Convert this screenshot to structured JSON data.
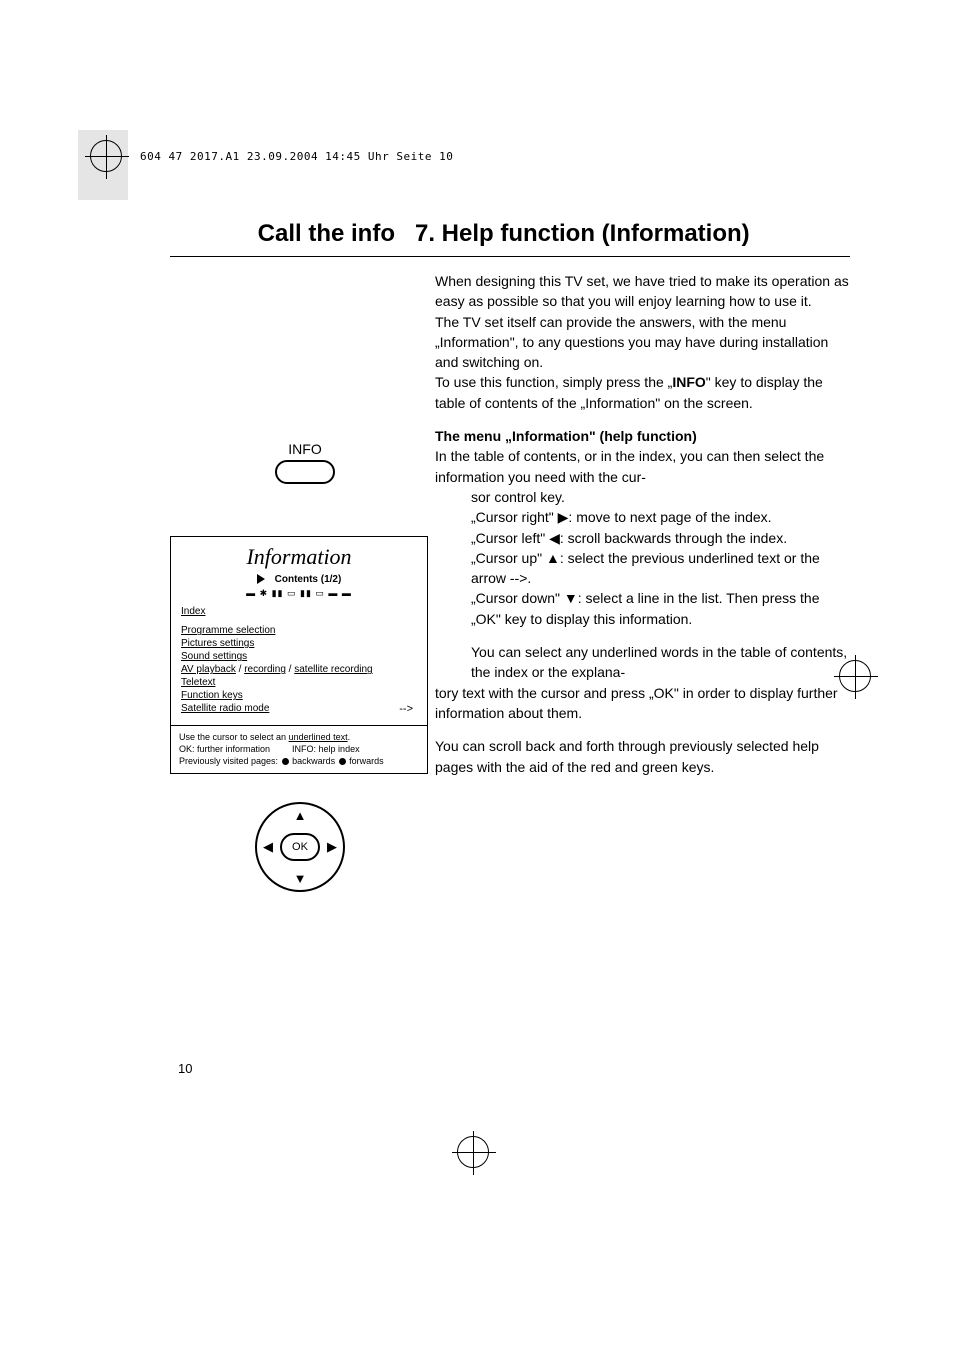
{
  "header_line": "604 47 2017.A1  23.09.2004  14:45 Uhr  Seite 10",
  "title_left": "Call the info",
  "title_right": "7. Help function (Information)",
  "info_label": "INFO",
  "para1": "When designing this TV set, we have tried to make its operation as easy as possible so that you will enjoy learning how to use it.",
  "para1b": "The TV set itself can provide the answers, with the menu „Information\", to any questions you may have during installation and switching on.",
  "para1c_a": "To use this function, simply press the „",
  "para1c_bold": "INFO",
  "para1c_b": "\" key to display the table of contents of the „Information\" on the screen.",
  "subhead": "The menu „Information\" (help function)",
  "para2": "In the table of contents, or in the index, you can then select the information you need with the cur-",
  "para2_cont": "sor control key.",
  "cursor_right": "„Cursor right\" ▶: move to next page of the index.",
  "cursor_left": "„Cursor left\" ◀: scroll backwards through the index.",
  "cursor_up": "„Cursor up\" ▲: select the previous underlined text or the arrow -->.",
  "cursor_down": "„Cursor down\" ▼: select a line in the list. Then press the „OK\" key to display this information.",
  "para3a": "You can select any underlined words in the table of contents, the index or the explana-",
  "para3b": "tory text with the cursor and press „OK\" in order to display further information about them.",
  "para4": "You can scroll back and forth through previously selected help pages with the aid of the red and green keys.",
  "osd": {
    "title": "Information",
    "contents": "Contents (1/2)",
    "index": "Index",
    "links": {
      "prog": "Programme selection",
      "pict": "Pictures settings",
      "sound": "Sound settings",
      "av": "AV playback",
      "rec": "recording",
      "sat": "satellite recording",
      "teletext": "Teletext",
      "func": "Function keys",
      "satradio": "Satellite radio mode",
      "arrow": "-->"
    },
    "bottom1a": "Use the cursor to select an ",
    "bottom1b": "underlined text",
    "bottom1c": ".",
    "bottom2a": "OK: further information",
    "bottom2b": "INFO: help index",
    "bottom3a": "Previously visited pages: ",
    "bottom3b": " backwards ",
    "bottom3c": " forwards"
  },
  "ok_label": "OK",
  "page_number": "10"
}
